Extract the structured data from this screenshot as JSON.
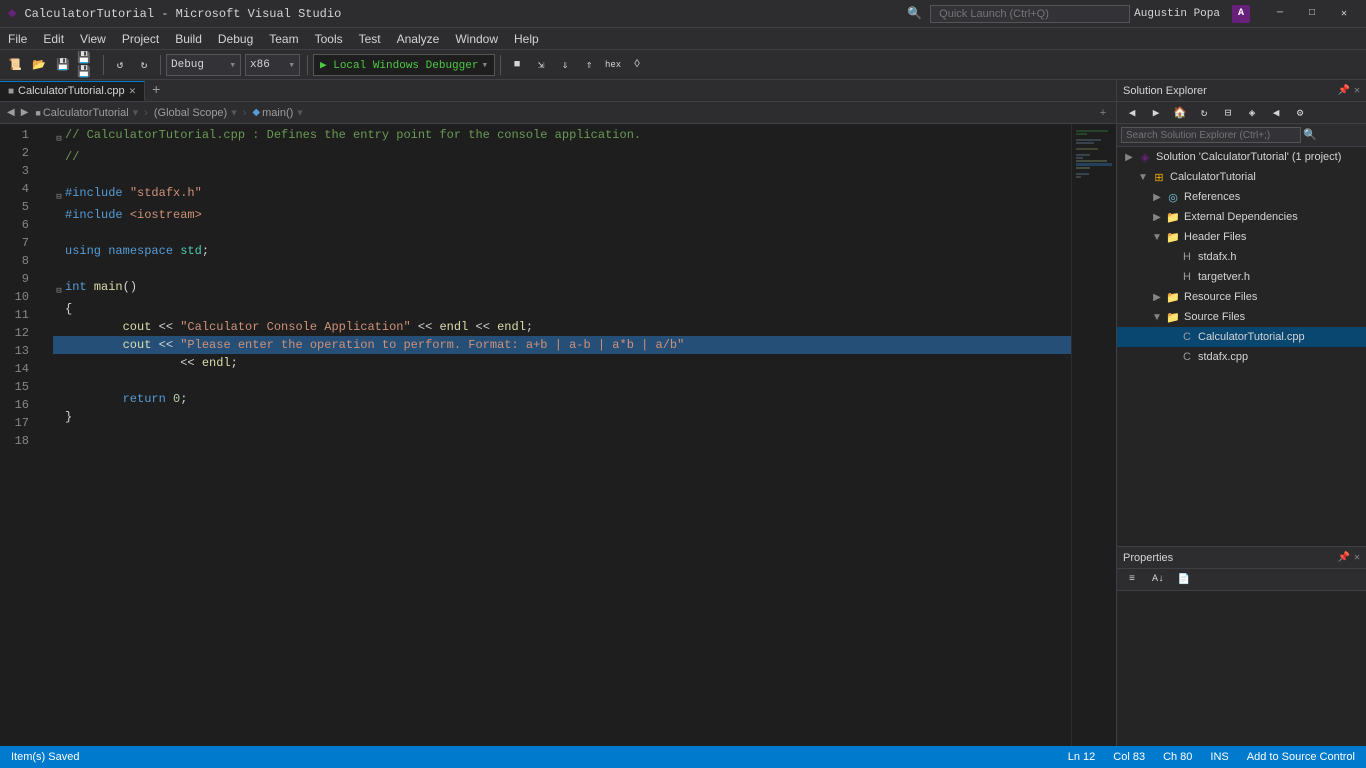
{
  "titleBar": {
    "logo": "A",
    "title": "CalculatorTutorial - Microsoft Visual Studio",
    "searchPlaceholder": "Quick Launch (Ctrl+Q)",
    "user": "Augustin Popa",
    "avatarLabel": "A",
    "minimize": "─",
    "restore": "□",
    "close": "✕"
  },
  "menuBar": {
    "items": [
      "File",
      "Edit",
      "View",
      "Project",
      "Build",
      "Debug",
      "Team",
      "Tools",
      "Test",
      "Analyze",
      "Window",
      "Help"
    ]
  },
  "toolbar": {
    "debugMode": "Debug",
    "arch": "x86",
    "runLabel": "▶  Local Windows Debugger",
    "runDropdown": "▾"
  },
  "tabs": [
    {
      "label": "CalculatorTutorial.cpp",
      "active": true,
      "modified": false
    }
  ],
  "filepathBar": {
    "project": "CalculatorTutorial",
    "scope": "(Global Scope)",
    "symbol": "main()"
  },
  "codeLines": [
    {
      "num": 1,
      "content": "// CalculatorTutorial.cpp : Defines the entry point for the console application.",
      "type": "comment",
      "fold": true
    },
    {
      "num": 2,
      "content": "//",
      "type": "comment"
    },
    {
      "num": 3,
      "content": "",
      "type": "blank"
    },
    {
      "num": 4,
      "content": "#include \"stdafx.h\"",
      "type": "preprocessor",
      "fold": true
    },
    {
      "num": 5,
      "content": "#include <iostream>",
      "type": "preprocessor"
    },
    {
      "num": 6,
      "content": "",
      "type": "blank"
    },
    {
      "num": 7,
      "content": "using namespace std;",
      "type": "code"
    },
    {
      "num": 8,
      "content": "",
      "type": "blank"
    },
    {
      "num": 9,
      "content": "int main()",
      "type": "code",
      "fold": true
    },
    {
      "num": 10,
      "content": "{",
      "type": "code"
    },
    {
      "num": 11,
      "content": "\tcout << \"Calculator Console Application\" << endl << endl;",
      "type": "code"
    },
    {
      "num": 12,
      "content": "\tcout << \"Please enter the operation to perform. Format: a+b | a-b | a*b | a/b\"",
      "type": "code",
      "highlighted": true
    },
    {
      "num": 13,
      "content": "\t\t<< endl;",
      "type": "code"
    },
    {
      "num": 14,
      "content": "",
      "type": "blank"
    },
    {
      "num": 15,
      "content": "\treturn 0;",
      "type": "code"
    },
    {
      "num": 16,
      "content": "}",
      "type": "code"
    },
    {
      "num": 17,
      "content": "",
      "type": "blank"
    },
    {
      "num": 18,
      "content": "",
      "type": "blank"
    }
  ],
  "solutionExplorer": {
    "title": "Solution Explorer",
    "searchPlaceholder": "Search Solution Explorer (Ctrl+;)",
    "tree": [
      {
        "level": 0,
        "expand": "▶",
        "icon": "solution",
        "label": "Solution 'CalculatorTutorial' (1 project)",
        "type": "solution"
      },
      {
        "level": 1,
        "expand": "▼",
        "icon": "project",
        "label": "CalculatorTutorial",
        "type": "project"
      },
      {
        "level": 2,
        "expand": "▶",
        "icon": "ref",
        "label": "References",
        "type": "folder"
      },
      {
        "level": 2,
        "expand": "▶",
        "icon": "folder",
        "label": "External Dependencies",
        "type": "folder"
      },
      {
        "level": 2,
        "expand": "▼",
        "icon": "folder",
        "label": "Header Files",
        "type": "folder"
      },
      {
        "level": 3,
        "expand": "",
        "icon": "h",
        "label": "stdafx.h",
        "type": "file"
      },
      {
        "level": 3,
        "expand": "",
        "icon": "h",
        "label": "targetver.h",
        "type": "file"
      },
      {
        "level": 2,
        "expand": "▶",
        "icon": "folder",
        "label": "Resource Files",
        "type": "folder"
      },
      {
        "level": 2,
        "expand": "▼",
        "icon": "folder",
        "label": "Source Files",
        "type": "folder"
      },
      {
        "level": 3,
        "expand": "",
        "icon": "cpp",
        "label": "CalculatorTutorial.cpp",
        "type": "file",
        "selected": true
      },
      {
        "level": 3,
        "expand": "",
        "icon": "cpp",
        "label": "stdafx.cpp",
        "type": "file"
      }
    ]
  },
  "properties": {
    "title": "Properties"
  },
  "statusBar": {
    "message": "Item(s) Saved",
    "line": "Ln 12",
    "col": "Col 83",
    "ch": "Ch 80",
    "mode": "INS",
    "sourceControl": "Add to Source Control"
  }
}
